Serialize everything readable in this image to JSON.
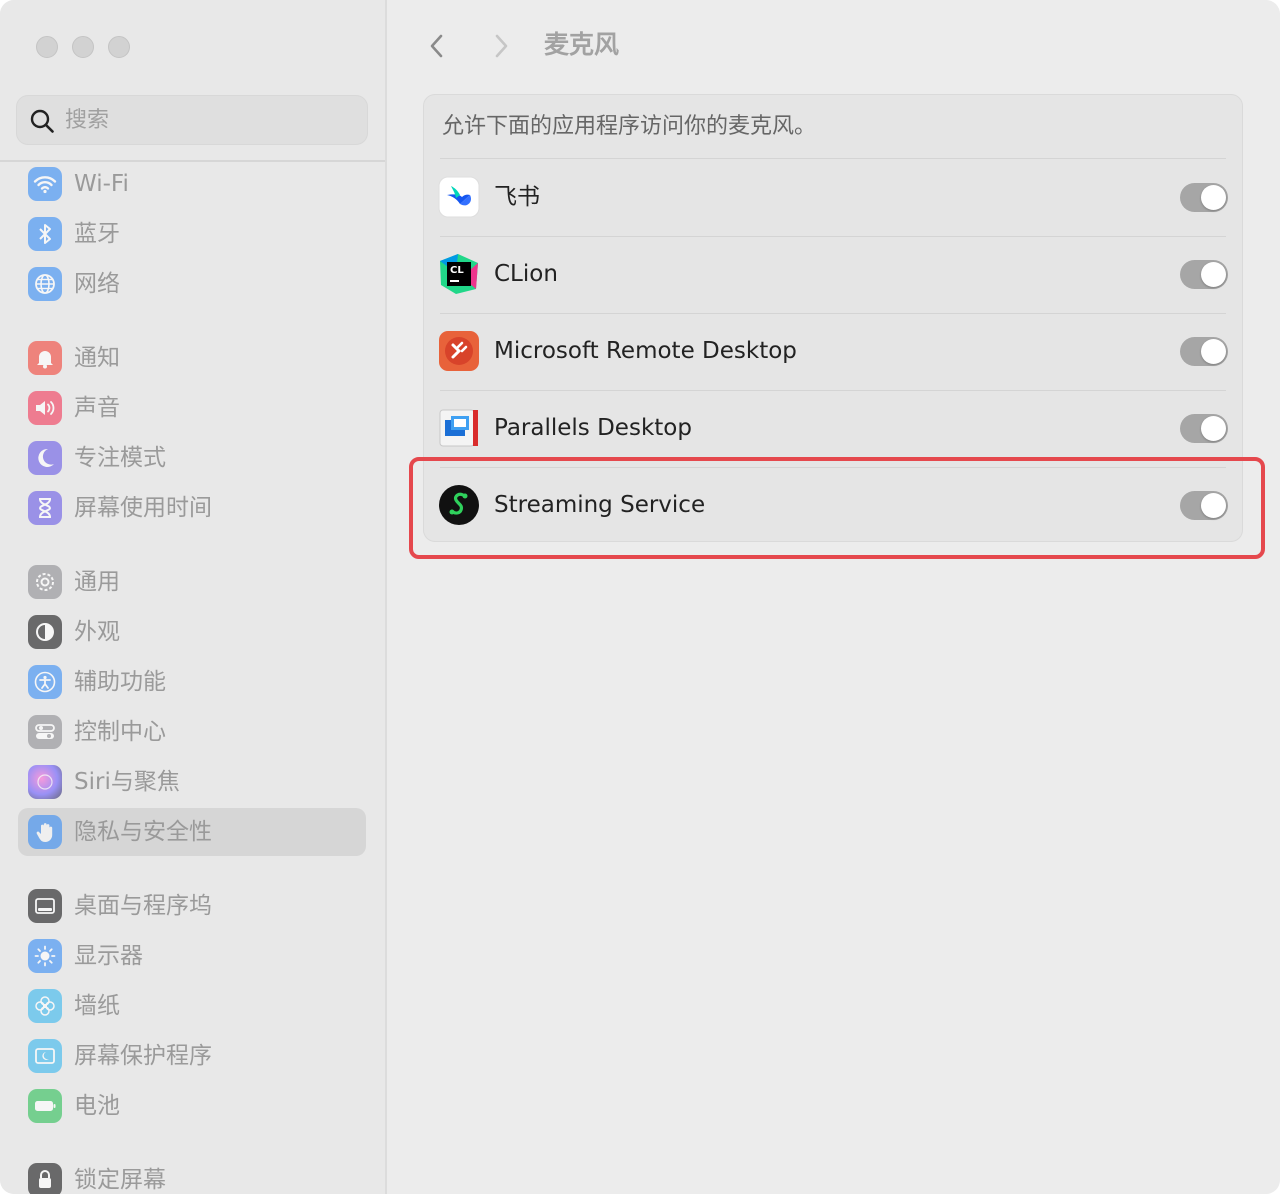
{
  "window": {
    "title": "麦克风"
  },
  "sidebar": {
    "search_placeholder": "搜索",
    "items": [
      {
        "label": "Wi-Fi",
        "icon": "wifi-icon",
        "color": "#3a8ef6"
      },
      {
        "label": "蓝牙",
        "icon": "bluetooth-icon",
        "color": "#3a8ef6"
      },
      {
        "label": "网络",
        "icon": "globe-icon",
        "color": "#3a8ef6"
      },
      {
        "label": "通知",
        "icon": "bell-icon",
        "color": "#f2463b"
      },
      {
        "label": "声音",
        "icon": "speaker-icon",
        "color": "#f23b5b"
      },
      {
        "label": "专注模式",
        "icon": "moon-icon",
        "color": "#6c5ce7"
      },
      {
        "label": "屏幕使用时间",
        "icon": "hourglass-icon",
        "color": "#6c5ce7"
      },
      {
        "label": "通用",
        "icon": "gear-icon",
        "color": "#8e8e93"
      },
      {
        "label": "外观",
        "icon": "appearance-icon",
        "color": "#1c1c1e"
      },
      {
        "label": "辅助功能",
        "icon": "accessibility-icon",
        "color": "#3a8ef6"
      },
      {
        "label": "控制中心",
        "icon": "control-center-icon",
        "color": "#8e8e93"
      },
      {
        "label": "Siri与聚焦",
        "icon": "siri-icon",
        "color": "#a24bd8"
      },
      {
        "label": "隐私与安全性",
        "icon": "hand-icon",
        "color": "#3a8ef6"
      },
      {
        "label": "桌面与程序坞",
        "icon": "dock-icon",
        "color": "#1c1c1e"
      },
      {
        "label": "显示器",
        "icon": "sun-icon",
        "color": "#3a8ef6"
      },
      {
        "label": "墙纸",
        "icon": "flower-icon",
        "color": "#3bb8f0"
      },
      {
        "label": "屏幕保护程序",
        "icon": "screensaver-icon",
        "color": "#3bb8f0"
      },
      {
        "label": "电池",
        "icon": "battery-icon",
        "color": "#30c15a"
      },
      {
        "label": "锁定屏幕",
        "icon": "lock-icon",
        "color": "#1c1c1e"
      }
    ],
    "selected": "隐私与安全性"
  },
  "main": {
    "description": "允许下面的应用程序访问你的麦克风。",
    "apps": [
      {
        "name": "飞书",
        "icon": "feishu-icon",
        "enabled": false
      },
      {
        "name": "CLion",
        "icon": "clion-icon",
        "enabled": false
      },
      {
        "name": "Microsoft Remote Desktop",
        "icon": "remote-desktop-icon",
        "enabled": false
      },
      {
        "name": "Parallels Desktop",
        "icon": "parallels-icon",
        "enabled": false
      },
      {
        "name": "Streaming Service",
        "icon": "streaming-service-icon",
        "enabled": false
      }
    ]
  }
}
